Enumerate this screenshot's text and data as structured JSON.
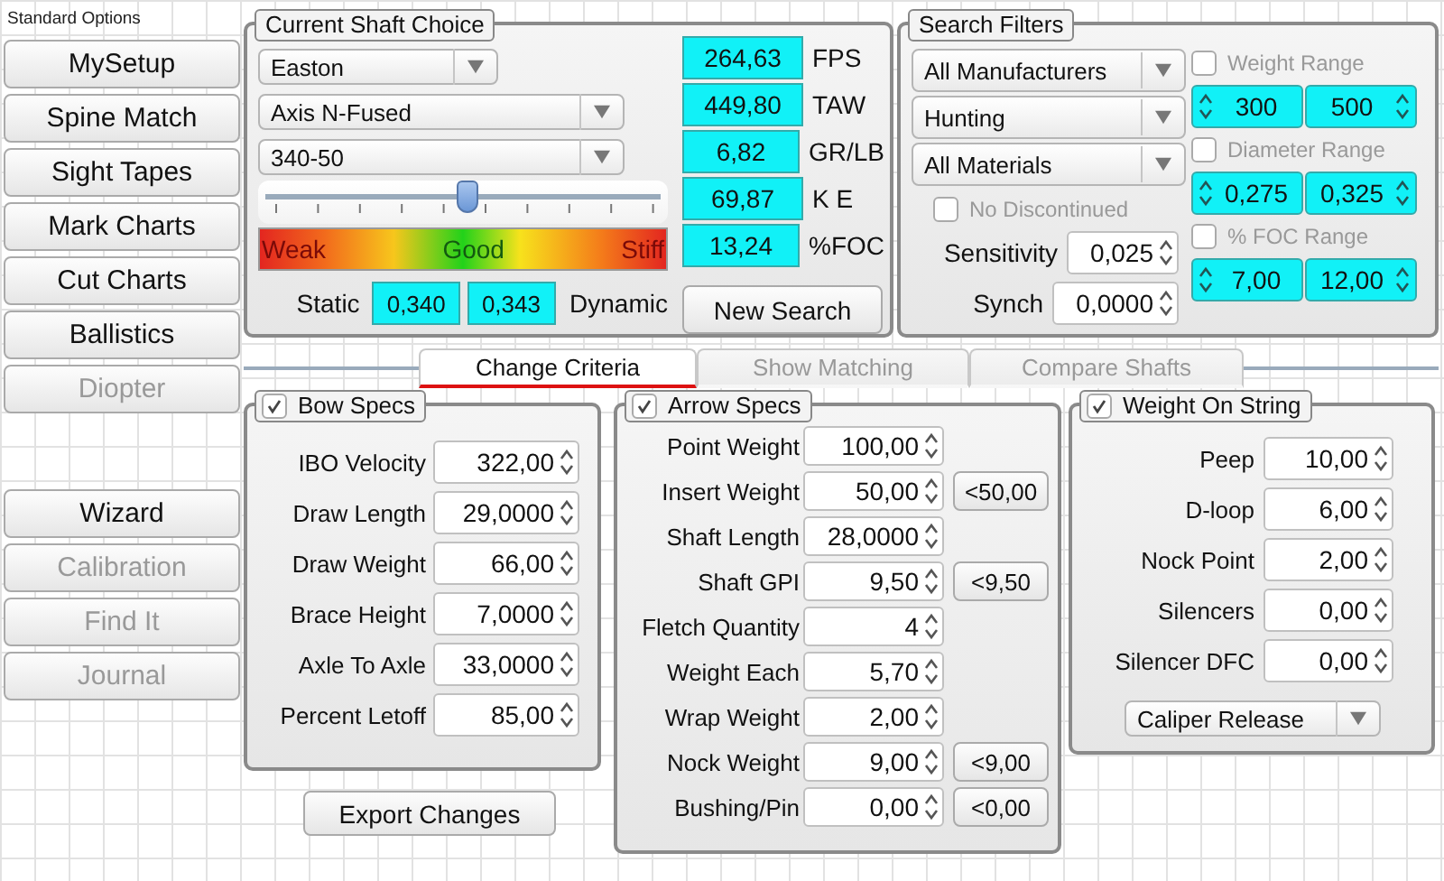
{
  "sidebar": {
    "title": "Standard Options",
    "groups": [
      [
        {
          "label": "MySetup",
          "disabled": false
        },
        {
          "label": "Spine Match",
          "disabled": false
        },
        {
          "label": "Sight Tapes",
          "disabled": false
        },
        {
          "label": "Mark Charts",
          "disabled": false
        },
        {
          "label": "Cut Charts",
          "disabled": false
        },
        {
          "label": "Ballistics",
          "disabled": false
        },
        {
          "label": "Diopter",
          "disabled": true
        }
      ],
      [
        {
          "label": "Wizard",
          "disabled": false
        },
        {
          "label": "Calibration",
          "disabled": true
        },
        {
          "label": "Find It",
          "disabled": true
        },
        {
          "label": "Journal",
          "disabled": true
        }
      ]
    ]
  },
  "shaft_choice": {
    "title": "Current Shaft Choice",
    "dropdowns": [
      "Easton",
      "Axis N-Fused",
      "340-50"
    ],
    "slider": {
      "level": 0.51
    },
    "scale_labels": [
      "Weak",
      "Good",
      "Stiff"
    ],
    "static_label": "Static",
    "static_value": "0,340",
    "dynamic_value": "0,343",
    "dynamic_label": "Dynamic",
    "readouts": [
      {
        "value": "264,63",
        "unit": "FPS"
      },
      {
        "value": "449,80",
        "unit": "TAW"
      },
      {
        "value": "6,82",
        "unit": "GR/LB"
      },
      {
        "value": "69,87",
        "unit": "K E"
      },
      {
        "value": "13,24",
        "unit": "%FOC"
      }
    ],
    "button": "New Search"
  },
  "search_filters": {
    "title": "Search Filters",
    "dropdowns": [
      "All Manufacturers",
      "Hunting",
      "All Materials"
    ],
    "no_discontinued": {
      "label": "No Discontinued",
      "checked": false
    },
    "settings": [
      {
        "label": "Sensitivity",
        "value": "0,025"
      },
      {
        "label": "Synch",
        "value": "0,0000"
      }
    ],
    "ranges": [
      {
        "label": "Weight Range",
        "checked": false,
        "min": "300",
        "max": "500"
      },
      {
        "label": "Diameter Range",
        "checked": false,
        "min": "0,275",
        "max": "0,325"
      },
      {
        "label": "% FOC Range",
        "checked": false,
        "min": "7,00",
        "max": "12,00"
      }
    ]
  },
  "tabs": [
    {
      "label": "Change Criteria",
      "selected": true
    },
    {
      "label": "Show Matching",
      "selected": false
    },
    {
      "label": "Compare Shafts",
      "selected": false
    }
  ],
  "panels": [
    {
      "kind": "bow",
      "title": "Bow Specs",
      "checked": true,
      "fields": [
        {
          "label": "IBO Velocity",
          "value": "322,00"
        },
        {
          "label": "Draw Length",
          "value": "29,0000"
        },
        {
          "label": "Draw Weight",
          "value": "66,00"
        },
        {
          "label": "Brace Height",
          "value": "7,0000"
        },
        {
          "label": "Axle To Axle",
          "value": "33,0000"
        },
        {
          "label": "Percent Letoff",
          "value": "85,00"
        }
      ]
    },
    {
      "kind": "arrow",
      "title": "Arrow Specs",
      "checked": true,
      "fields": [
        {
          "label": "Point Weight",
          "value": "100,00"
        },
        {
          "label": "Insert Weight",
          "value": "50,00",
          "limit": "<50,00"
        },
        {
          "label": "Shaft Length",
          "value": "28,0000"
        },
        {
          "label": "Shaft GPI",
          "value": "9,50",
          "limit": "<9,50"
        },
        {
          "label": "Fletch Quantity",
          "value": "4"
        },
        {
          "label": "Weight Each",
          "value": "5,70"
        },
        {
          "label": "Wrap Weight",
          "value": "2,00"
        },
        {
          "label": "Nock Weight",
          "value": "9,00",
          "limit": "<9,00"
        },
        {
          "label": "Bushing/Pin",
          "value": "0,00",
          "limit": "<0,00"
        }
      ]
    },
    {
      "kind": "string",
      "title": "Weight On String",
      "checked": true,
      "fields": [
        {
          "label": "Peep",
          "value": "10,00"
        },
        {
          "label": "D-loop",
          "value": "6,00"
        },
        {
          "label": "Nock Point",
          "value": "2,00"
        },
        {
          "label": "Silencers",
          "value": "0,00"
        },
        {
          "label": "Silencer DFC",
          "value": "0,00"
        }
      ],
      "dropdown": "Caliper Release"
    }
  ],
  "export_button": "Export Changes"
}
